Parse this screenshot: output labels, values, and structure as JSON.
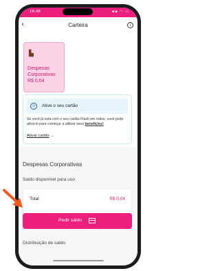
{
  "status": {
    "time": "16:48",
    "icons": "▪▪ ◠ ▭"
  },
  "header": {
    "title": "Carteira",
    "back_icon": "back-arrow-icon",
    "info_icon": "info-icon"
  },
  "card": {
    "icon": "building-icon",
    "name": "Despesas Corporativas",
    "amount": "R$ 0,04"
  },
  "activate": {
    "title": "Ative o seu cartão",
    "text": "Se você já está com o seu cartão Flash em mãos, você pode ativá-lo para começar a utilizar seus ",
    "text_link": "benefícios!",
    "link_label": "Ativar cartão",
    "link_arrow": "→"
  },
  "section": {
    "title": "Despesas Corporativas",
    "subtitle": "Saldo disponível para uso"
  },
  "total": {
    "label": "Total",
    "value": "R$ 0,04"
  },
  "button": {
    "label": "Pedir saldo",
    "icon": "card-icon"
  },
  "distribution": {
    "title": "Distribuição de saldo"
  },
  "colors": {
    "brand": "#ec1e7e",
    "card_bg": "#fbd3e6",
    "arrow": "#f05a24"
  }
}
